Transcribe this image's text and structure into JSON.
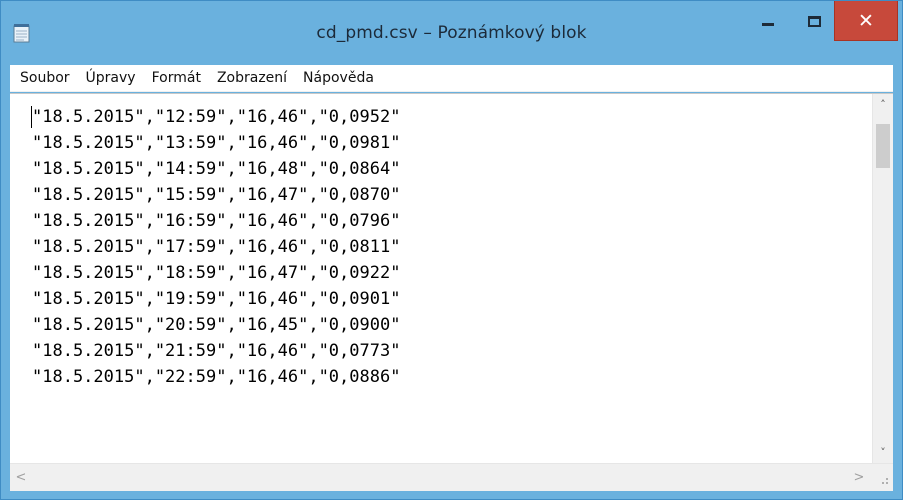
{
  "window": {
    "title": "cd_pmd.csv – Poznámkový blok",
    "app_icon": "notepad-icon",
    "controls": {
      "minimize_icon": "minimize-icon",
      "maximize_icon": "maximize-icon",
      "close_label": "✕"
    },
    "colors": {
      "frame": "#6ab1de",
      "close_button": "#c7493b"
    }
  },
  "menu": {
    "items": [
      {
        "label": "Soubor"
      },
      {
        "label": "Úpravy"
      },
      {
        "label": "Formát"
      },
      {
        "label": "Zobrazení"
      },
      {
        "label": "Nápověda"
      }
    ]
  },
  "editor": {
    "lines": [
      "\"18.5.2015\",\"12:59\",\"16,46\",\"0,0952\"",
      "\"18.5.2015\",\"13:59\",\"16,46\",\"0,0981\"",
      "\"18.5.2015\",\"14:59\",\"16,48\",\"0,0864\"",
      "\"18.5.2015\",\"15:59\",\"16,47\",\"0,0870\"",
      "\"18.5.2015\",\"16:59\",\"16,46\",\"0,0796\"",
      "\"18.5.2015\",\"17:59\",\"16,46\",\"0,0811\"",
      "\"18.5.2015\",\"18:59\",\"16,47\",\"0,0922\"",
      "\"18.5.2015\",\"19:59\",\"16,46\",\"0,0901\"",
      "\"18.5.2015\",\"20:59\",\"16,45\",\"0,0900\"",
      "\"18.5.2015\",\"21:59\",\"16,46\",\"0,0773\"",
      "\"18.5.2015\",\"22:59\",\"16,46\",\"0,0886\""
    ]
  },
  "scrollbars": {
    "up_arrow": "˄",
    "down_arrow": "˅",
    "left_arrow": "<",
    "right_arrow": ">"
  }
}
